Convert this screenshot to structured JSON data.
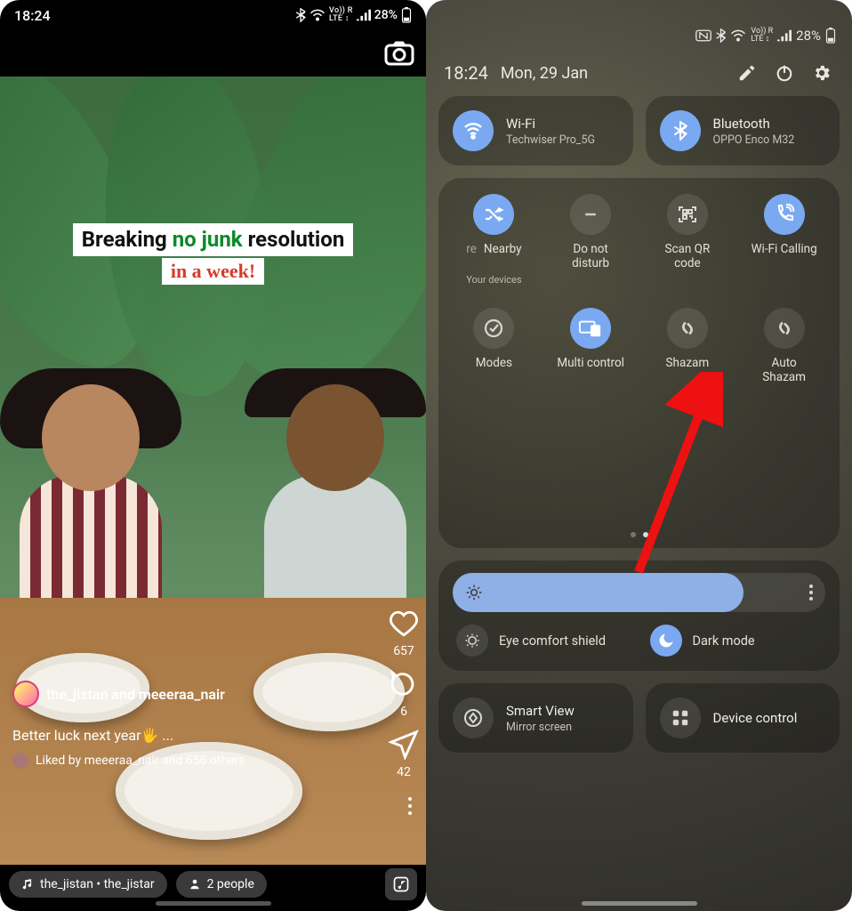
{
  "left": {
    "status": {
      "time": "18:24",
      "battery": "28%"
    },
    "story": {
      "headline_part1": "Breaking ",
      "headline_green": "no junk",
      "headline_part2": " resolution",
      "headline_line2": "in a week!",
      "users_text": "the_jistan and meeeraa_nair",
      "caption": "Better luck next year🖐 ...",
      "liked_by": "Liked by meeeraa_nair and 656 others",
      "like_count": "657",
      "comment_count": "6",
      "share_count": "42",
      "music_pill": "the_jistan • the_jistar",
      "people_pill": "2 people"
    }
  },
  "right": {
    "status": {
      "battery": "28%"
    },
    "header": {
      "time": "18:24",
      "date": "Mon, 29 Jan"
    },
    "wifi": {
      "title": "Wi-Fi",
      "subtitle": "Techwiser Pro_5G",
      "active": true
    },
    "bluetooth": {
      "title": "Bluetooth",
      "subtitle": "OPPO Enco M32",
      "active": true
    },
    "quick": [
      {
        "id": "nearby",
        "label": "Nearby",
        "sublabel": "Your devices",
        "label_prefix": "re",
        "active": true,
        "icon": "shuffle"
      },
      {
        "id": "dnd",
        "label": "Do not disturb",
        "active": false,
        "icon": "minus"
      },
      {
        "id": "qr",
        "label": "Scan QR code",
        "active": false,
        "icon": "qr"
      },
      {
        "id": "wificall",
        "label": "Wi-Fi Calling",
        "active": true,
        "icon": "phone-wifi"
      },
      {
        "id": "modes",
        "label": "Modes",
        "active": false,
        "icon": "check-circle"
      },
      {
        "id": "multi",
        "label": "Multi control",
        "active": true,
        "icon": "devices"
      },
      {
        "id": "shazam",
        "label": "Shazam",
        "active": false,
        "icon": "shazam",
        "highlighted": true
      },
      {
        "id": "autoshazam",
        "label": "Auto Shazam",
        "active": false,
        "icon": "shazam"
      }
    ],
    "brightness_percent": 78,
    "eye_comfort": {
      "label": "Eye comfort shield",
      "active": false
    },
    "dark_mode": {
      "label": "Dark mode",
      "active": true
    },
    "smart_view": {
      "title": "Smart View",
      "subtitle": "Mirror screen"
    },
    "device_control": {
      "title": "Device control"
    }
  }
}
